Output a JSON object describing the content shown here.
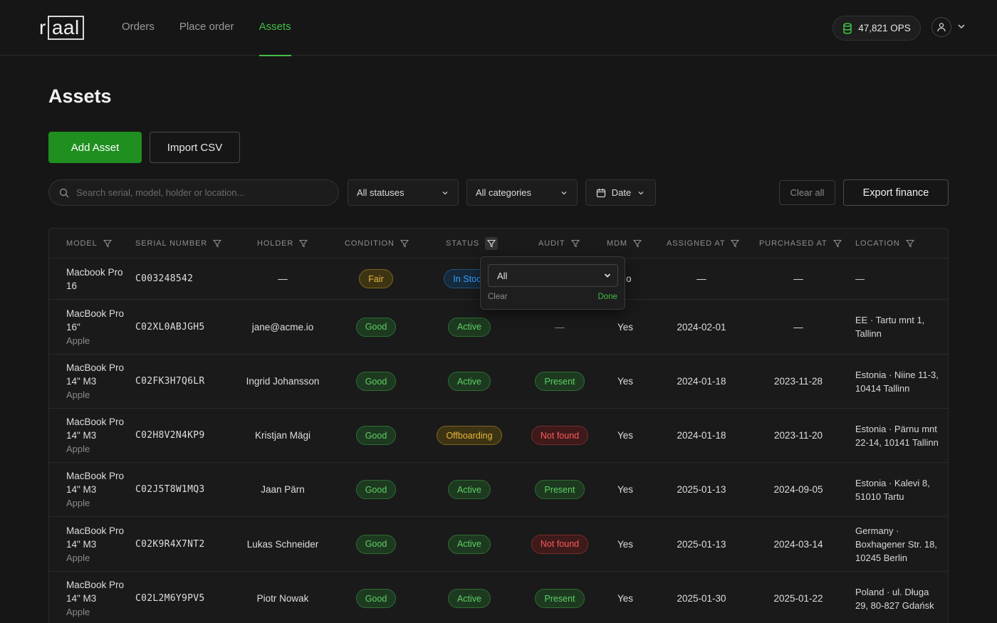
{
  "brand": {
    "logo_prefix": "r",
    "logo_boxed": "aal"
  },
  "nav": {
    "items": [
      {
        "label": "Orders"
      },
      {
        "label": "Place order"
      },
      {
        "label": "Assets"
      }
    ]
  },
  "header": {
    "ops_value": "47,821 OPS",
    "ops_icon": "coins-icon",
    "user_icon": "user-icon"
  },
  "page": {
    "title": "Assets"
  },
  "actions": {
    "add_label": "Add Asset",
    "import_label": "Import CSV"
  },
  "filters": {
    "search_placeholder": "Search serial, model, holder or location...",
    "status": "All statuses",
    "category": "All categories",
    "date": "Date",
    "clear_all": "Clear all",
    "export": "Export finance"
  },
  "table": {
    "headers": [
      "MODEL",
      "SERIAL NUMBER",
      "HOLDER",
      "CONDITION",
      "STATUS",
      "AUDIT",
      "MDM",
      "ASSIGNED AT",
      "PURCHASED AT",
      "LOCATION"
    ],
    "rows": [
      {
        "model": "Macbook Pro 16",
        "brand": "",
        "serial": "C003248542",
        "holder": "—",
        "condition": "Fair",
        "status": "In Stock",
        "audit": "",
        "mdm": "No",
        "assigned": "—",
        "purchased": "—",
        "location": "—"
      },
      {
        "model": "MacBook Pro 16\"",
        "brand": "Apple",
        "serial": "C02XL0ABJGH5",
        "holder": "jane@acme.io",
        "condition": "Good",
        "status": "Active",
        "audit": "—",
        "mdm": "Yes",
        "assigned": "2024-02-01",
        "purchased": "—",
        "location": "EE · Tartu mnt 1, Tallinn"
      },
      {
        "model": "MacBook Pro 14\" M3",
        "brand": "Apple",
        "serial": "C02FK3H7Q6LR",
        "holder": "Ingrid Johansson",
        "condition": "Good",
        "status": "Active",
        "audit": "Present",
        "mdm": "Yes",
        "assigned": "2024-01-18",
        "purchased": "2023-11-28",
        "location": "Estonia · Niine 11-3, 10414 Tallinn"
      },
      {
        "model": "MacBook Pro 14\" M3",
        "brand": "Apple",
        "serial": "C02H8V2N4KP9",
        "holder": "Kristjan Mägi",
        "condition": "Good",
        "status": "Offboarding",
        "audit": "Not found",
        "mdm": "Yes",
        "assigned": "2024-01-18",
        "purchased": "2023-11-20",
        "location": "Estonia · Pärnu mnt 22-14, 10141 Tallinn"
      },
      {
        "model": "MacBook Pro 14\" M3",
        "brand": "Apple",
        "serial": "C02J5T8W1MQ3",
        "holder": "Jaan Pärn",
        "condition": "Good",
        "status": "Active",
        "audit": "Present",
        "mdm": "Yes",
        "assigned": "2025-01-13",
        "purchased": "2024-09-05",
        "location": "Estonia · Kalevi 8, 51010 Tartu"
      },
      {
        "model": "MacBook Pro 14\" M3",
        "brand": "Apple",
        "serial": "C02K9R4X7NT2",
        "holder": "Lukas Schneider",
        "condition": "Good",
        "status": "Active",
        "audit": "Not found",
        "mdm": "Yes",
        "assigned": "2025-01-13",
        "purchased": "2024-03-14",
        "location": "Germany · Boxhagener Str. 18, 10245 Berlin"
      },
      {
        "model": "MacBook Pro 14\" M3",
        "brand": "Apple",
        "serial": "C02L2M6Y9PV5",
        "holder": "Piotr Nowak",
        "condition": "Good",
        "status": "Active",
        "audit": "Present",
        "mdm": "Yes",
        "assigned": "2025-01-30",
        "purchased": "2025-01-22",
        "location": "Poland · ul. Długa 29, 80-827 Gdańsk"
      }
    ]
  },
  "status_popover": {
    "value": "All",
    "clear": "Clear",
    "done": "Done"
  },
  "colors": {
    "accent": "#3fbf45",
    "primary_button": "#1f8f1f",
    "background": "#161616"
  }
}
